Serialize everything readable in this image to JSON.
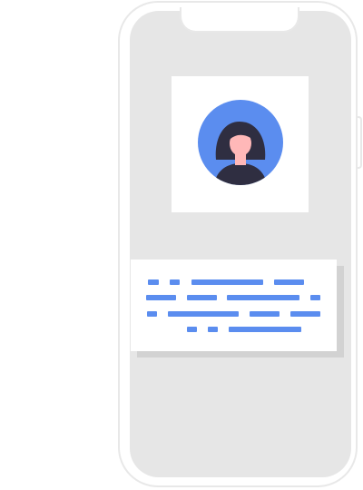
{
  "colors": {
    "accent": "#5b8def",
    "screen": "#e6e6e6",
    "frame": "#e8e8e8",
    "card": "#ffffff",
    "shadow": "#d2d2d2",
    "hair": "#2f2e41",
    "skin": "#ffb8b8",
    "shirt": "#2f2e41"
  },
  "phone": {
    "icons": [
      "phone-frame",
      "notch",
      "side-button"
    ]
  },
  "profile": {
    "avatar_icon": "user-avatar-icon"
  },
  "placeholder_text": {
    "icon": "text-placeholder-lines"
  }
}
